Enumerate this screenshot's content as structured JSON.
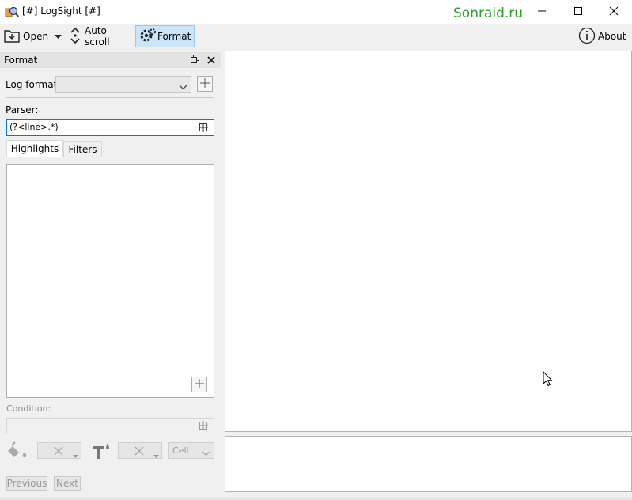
{
  "window": {
    "title": "[#] LogSight [#]",
    "watermark": "Sonraid.ru"
  },
  "toolbar": {
    "open_label": "Open",
    "auto_scroll_label": "Auto scroll",
    "format_label": "Format",
    "about_label": "About"
  },
  "format_panel": {
    "title": "Format",
    "log_format_label": "Log format:",
    "log_format_value": "",
    "parser_label": "Parser:",
    "parser_value": "(?<line>.*)",
    "tabs": [
      {
        "label": "Highlights",
        "active": true
      },
      {
        "label": "Filters",
        "active": false
      }
    ],
    "condition_label": "Condition:",
    "condition_value": "",
    "cell_select": "Cell",
    "previous_label": "Previous",
    "next_label": "Next"
  },
  "colors": {
    "format_active_bg": "#cce4f7",
    "watermark": "#2aa02a",
    "focus_border": "#0078d7"
  }
}
